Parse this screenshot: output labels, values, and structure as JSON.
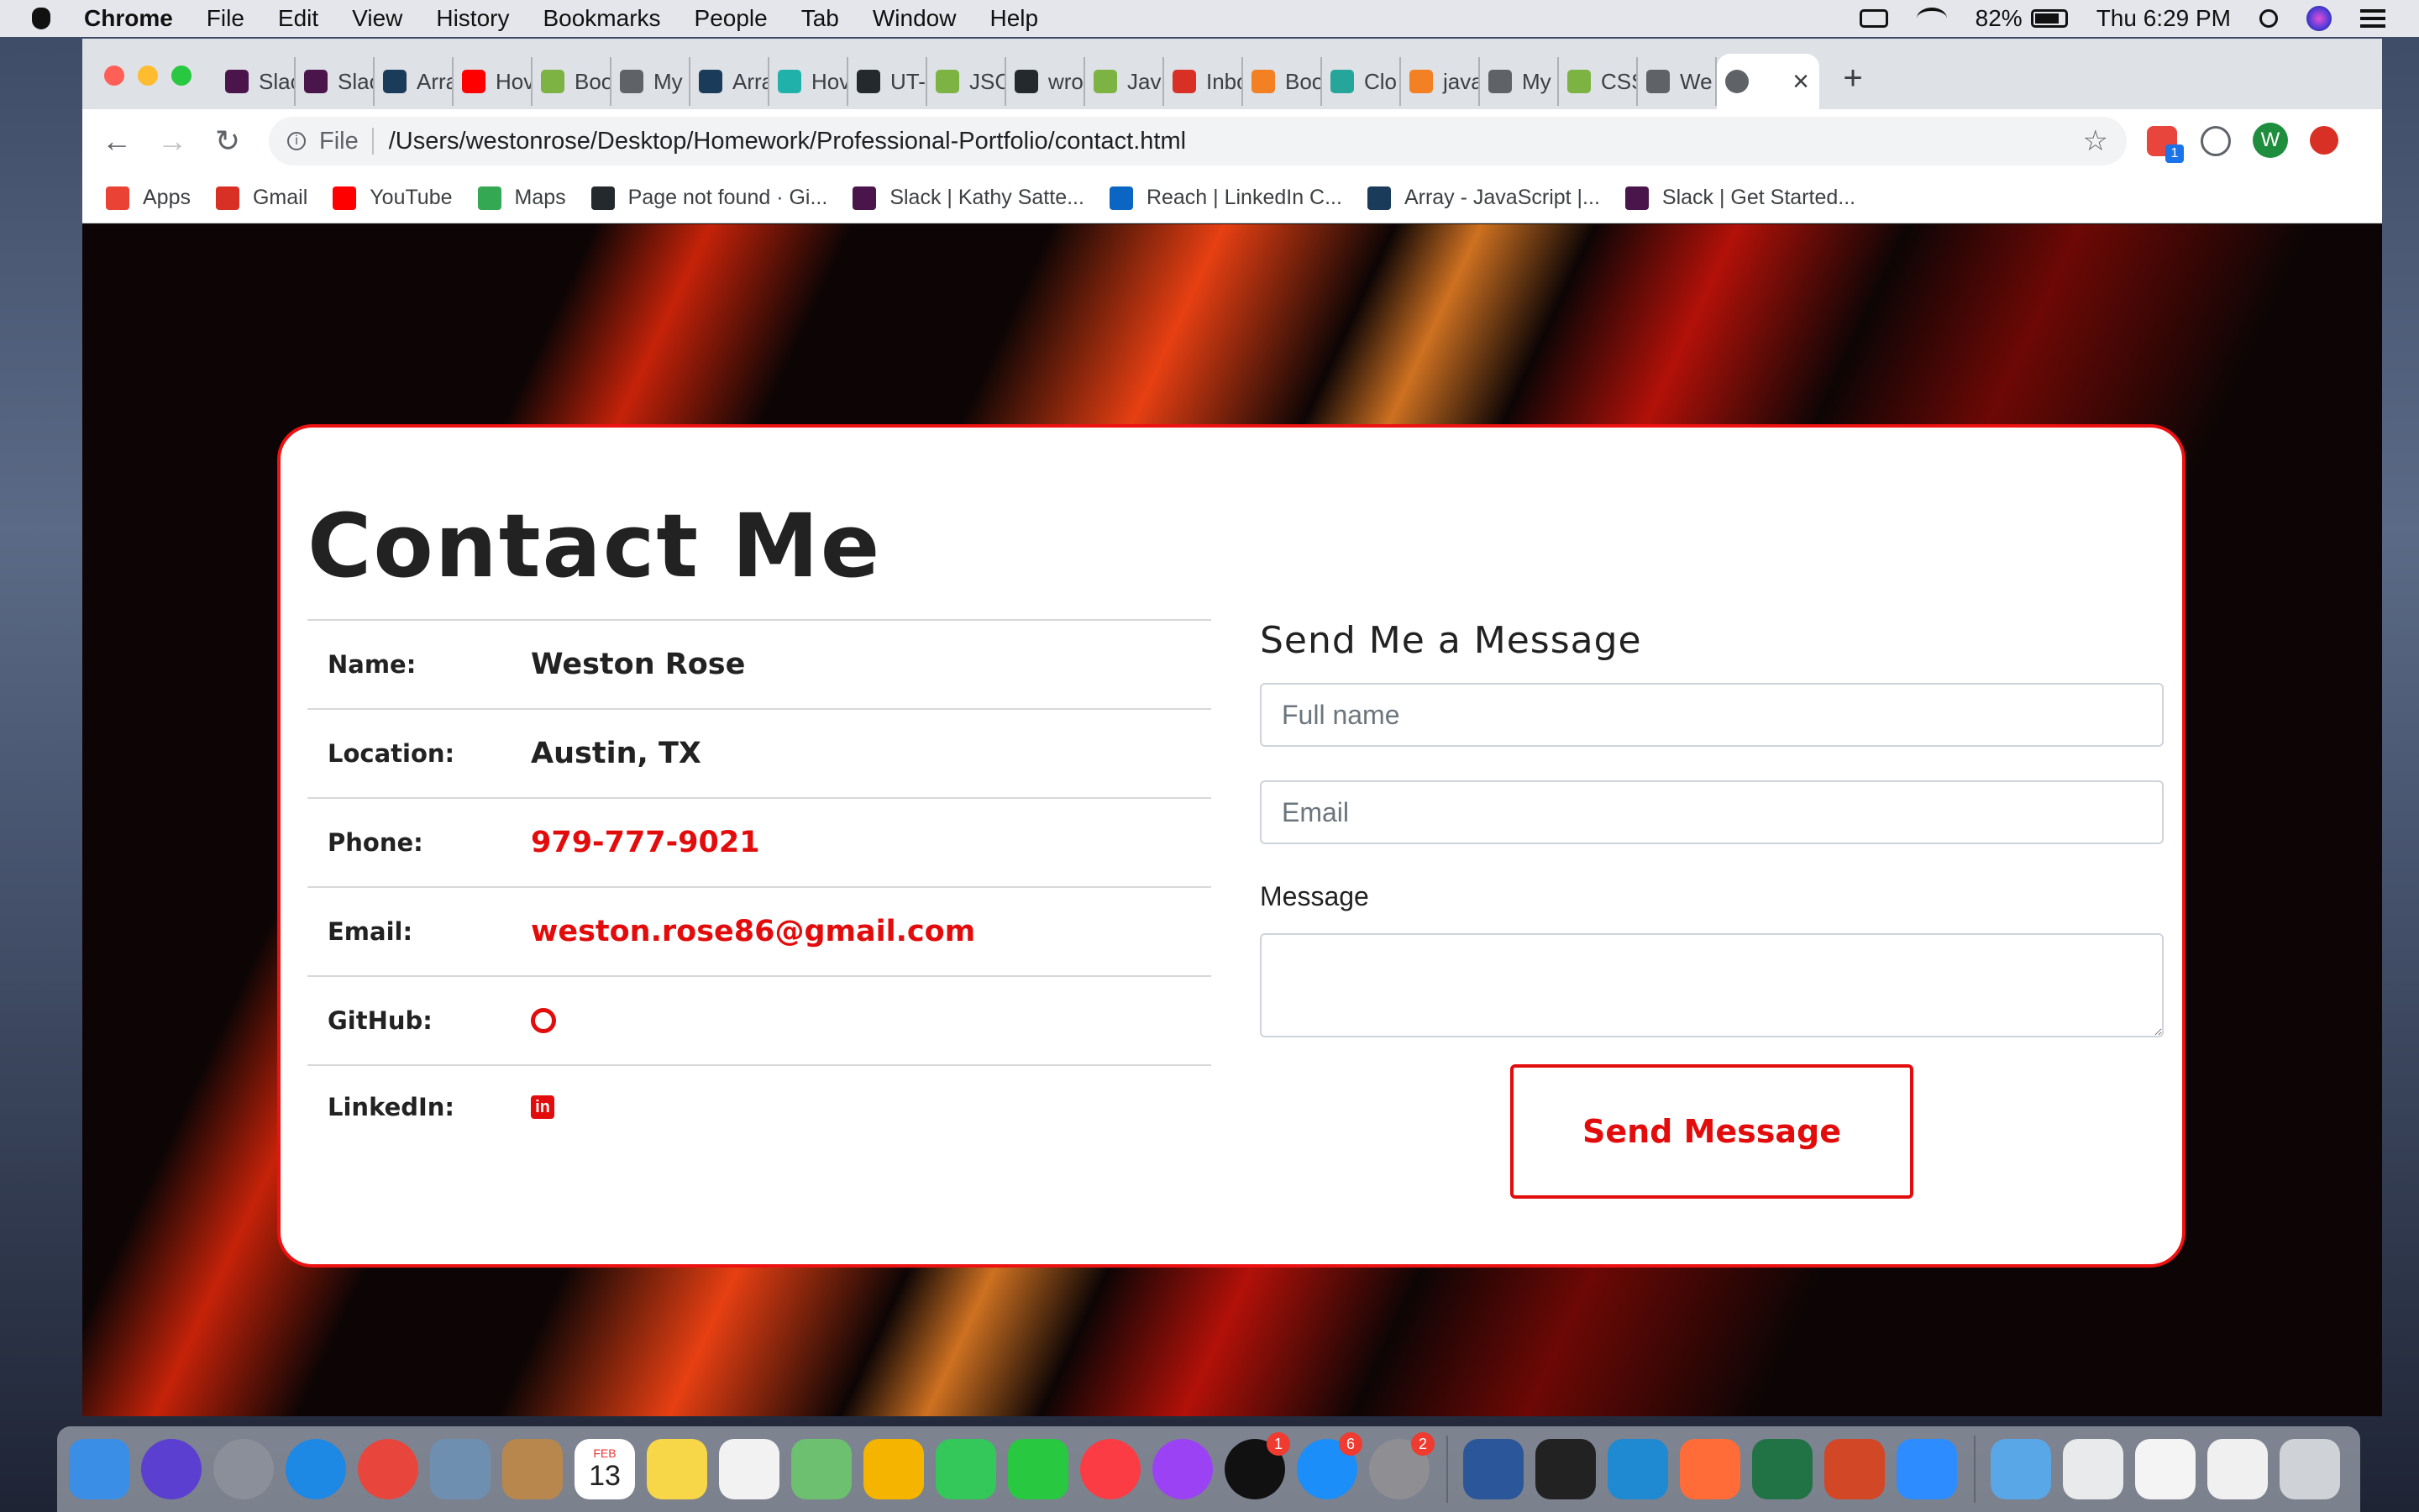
{
  "menubar": {
    "app": "Chrome",
    "items": [
      "File",
      "Edit",
      "View",
      "History",
      "Bookmarks",
      "People",
      "Tab",
      "Window",
      "Help"
    ],
    "battery": "82%",
    "clock": "Thu 6:29 PM"
  },
  "browser": {
    "tabs": [
      {
        "label": "Slac",
        "color": "#4a154b"
      },
      {
        "label": "Slac",
        "color": "#4a154b"
      },
      {
        "label": "Arra",
        "color": "#1a3c5a"
      },
      {
        "label": "Hov",
        "color": "#ff0000"
      },
      {
        "label": "Boo",
        "color": "#7cb342"
      },
      {
        "label": "My",
        "color": "#5f6368"
      },
      {
        "label": "Arra",
        "color": "#1a3c5a"
      },
      {
        "label": "Hov",
        "color": "#20b2aa"
      },
      {
        "label": "UT-",
        "color": "#24292e"
      },
      {
        "label": "JSC",
        "color": "#7cb342"
      },
      {
        "label": "wro",
        "color": "#24292e"
      },
      {
        "label": "Jav",
        "color": "#7cb342"
      },
      {
        "label": "Inbo",
        "color": "#d93025"
      },
      {
        "label": "Boo",
        "color": "#f48024"
      },
      {
        "label": "Clo",
        "color": "#26a69a"
      },
      {
        "label": "java",
        "color": "#f48024"
      },
      {
        "label": "My",
        "color": "#5f6368"
      },
      {
        "label": "CSS",
        "color": "#7cb342"
      },
      {
        "label": "We",
        "color": "#5f6368"
      }
    ],
    "active_tab_close": "×",
    "new_tab": "+",
    "url_scheme": "File",
    "url": "/Users/westonrose/Desktop/Homework/Professional-Portfolio/contact.html",
    "profile_initial": "W",
    "extension_badge": "1"
  },
  "bookmarks": [
    {
      "label": "Apps",
      "color": "#ea4335"
    },
    {
      "label": "Gmail",
      "color": "#d93025"
    },
    {
      "label": "YouTube",
      "color": "#ff0000"
    },
    {
      "label": "Maps",
      "color": "#34a853"
    },
    {
      "label": "Page not found · Gi...",
      "color": "#24292e"
    },
    {
      "label": "Slack | Kathy Satte...",
      "color": "#4a154b"
    },
    {
      "label": "Reach | LinkedIn C...",
      "color": "#0a66c2"
    },
    {
      "label": "Array - JavaScript |...",
      "color": "#1a3c5a"
    },
    {
      "label": "Slack | Get Started...",
      "color": "#4a154b"
    }
  ],
  "page": {
    "title": "Contact Me",
    "info": [
      {
        "label": "Name:",
        "value": "Weston Rose"
      },
      {
        "label": "Location:",
        "value": "Austin, TX"
      },
      {
        "label": "Phone:",
        "value": "979-777-9021"
      },
      {
        "label": "Email:",
        "value": "weston.rose86@gmail.com"
      },
      {
        "label": "GitHub:",
        "value": ""
      },
      {
        "label": "LinkedIn:",
        "value": "in"
      }
    ],
    "form": {
      "heading": "Send Me a Message",
      "name_placeholder": "Full name",
      "email_placeholder": "Email",
      "message_label": "Message",
      "submit_label": "Send Message"
    },
    "accent_color": "#e30c0c"
  },
  "dock": {
    "apps": [
      {
        "name": "finder",
        "color": "#3a8ee6"
      },
      {
        "name": "siri",
        "color": "#5b3fd0"
      },
      {
        "name": "launchpad",
        "color": "#8a8f99"
      },
      {
        "name": "safari",
        "color": "#1e88e5"
      },
      {
        "name": "chrome",
        "color": "#e8453c"
      },
      {
        "name": "preview",
        "color": "#6e8fb0"
      },
      {
        "name": "contacts",
        "color": "#b8874e"
      },
      {
        "name": "calendar",
        "color": "#ffffff"
      },
      {
        "name": "notes",
        "color": "#f7d648"
      },
      {
        "name": "reminders",
        "color": "#f2f2f2"
      },
      {
        "name": "maps",
        "color": "#6cc070"
      },
      {
        "name": "photos",
        "color": "#f4b400"
      },
      {
        "name": "messages",
        "color": "#34c759"
      },
      {
        "name": "facetime",
        "color": "#28c840"
      },
      {
        "name": "music",
        "color": "#fc3c44"
      },
      {
        "name": "podcasts",
        "color": "#9b42f5"
      },
      {
        "name": "tv",
        "color": "#111111",
        "badge": "1"
      },
      {
        "name": "app-store",
        "color": "#1c8ef9",
        "badge": "6"
      },
      {
        "name": "system-preferences",
        "color": "#8e8e93",
        "badge": "2"
      },
      {
        "name": "word",
        "color": "#2b579a"
      },
      {
        "name": "terminal",
        "color": "#222222"
      },
      {
        "name": "vscode",
        "color": "#1f8ad2"
      },
      {
        "name": "postman",
        "color": "#ff6c37"
      },
      {
        "name": "excel",
        "color": "#217346"
      },
      {
        "name": "powerpoint",
        "color": "#d24726"
      },
      {
        "name": "zoom",
        "color": "#2d8cff"
      }
    ],
    "calendar_month": "FEB",
    "calendar_day": "13",
    "right_items": [
      {
        "name": "downloads-folder",
        "color": "#5aa7e8"
      },
      {
        "name": "recent-screenshot-1",
        "color": "#e9eaec"
      },
      {
        "name": "recent-screenshot-2",
        "color": "#f4f4f4"
      },
      {
        "name": "recent-screenshot-3",
        "color": "#f0f0f0"
      },
      {
        "name": "trash",
        "color": "#cfd3d8"
      }
    ]
  }
}
